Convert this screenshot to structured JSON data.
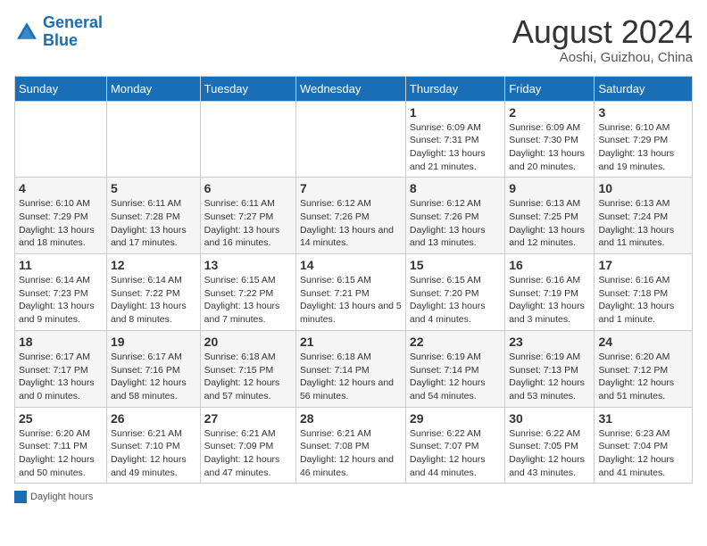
{
  "header": {
    "logo_general": "General",
    "logo_blue": "Blue",
    "main_title": "August 2024",
    "subtitle": "Aoshi, Guizhou, China"
  },
  "weekdays": [
    "Sunday",
    "Monday",
    "Tuesday",
    "Wednesday",
    "Thursday",
    "Friday",
    "Saturday"
  ],
  "weeks": [
    [
      {
        "day": "",
        "info": ""
      },
      {
        "day": "",
        "info": ""
      },
      {
        "day": "",
        "info": ""
      },
      {
        "day": "",
        "info": ""
      },
      {
        "day": "1",
        "info": "Sunrise: 6:09 AM\nSunset: 7:31 PM\nDaylight: 13 hours and 21 minutes."
      },
      {
        "day": "2",
        "info": "Sunrise: 6:09 AM\nSunset: 7:30 PM\nDaylight: 13 hours and 20 minutes."
      },
      {
        "day": "3",
        "info": "Sunrise: 6:10 AM\nSunset: 7:29 PM\nDaylight: 13 hours and 19 minutes."
      }
    ],
    [
      {
        "day": "4",
        "info": "Sunrise: 6:10 AM\nSunset: 7:29 PM\nDaylight: 13 hours and 18 minutes."
      },
      {
        "day": "5",
        "info": "Sunrise: 6:11 AM\nSunset: 7:28 PM\nDaylight: 13 hours and 17 minutes."
      },
      {
        "day": "6",
        "info": "Sunrise: 6:11 AM\nSunset: 7:27 PM\nDaylight: 13 hours and 16 minutes."
      },
      {
        "day": "7",
        "info": "Sunrise: 6:12 AM\nSunset: 7:26 PM\nDaylight: 13 hours and 14 minutes."
      },
      {
        "day": "8",
        "info": "Sunrise: 6:12 AM\nSunset: 7:26 PM\nDaylight: 13 hours and 13 minutes."
      },
      {
        "day": "9",
        "info": "Sunrise: 6:13 AM\nSunset: 7:25 PM\nDaylight: 13 hours and 12 minutes."
      },
      {
        "day": "10",
        "info": "Sunrise: 6:13 AM\nSunset: 7:24 PM\nDaylight: 13 hours and 11 minutes."
      }
    ],
    [
      {
        "day": "11",
        "info": "Sunrise: 6:14 AM\nSunset: 7:23 PM\nDaylight: 13 hours and 9 minutes."
      },
      {
        "day": "12",
        "info": "Sunrise: 6:14 AM\nSunset: 7:22 PM\nDaylight: 13 hours and 8 minutes."
      },
      {
        "day": "13",
        "info": "Sunrise: 6:15 AM\nSunset: 7:22 PM\nDaylight: 13 hours and 7 minutes."
      },
      {
        "day": "14",
        "info": "Sunrise: 6:15 AM\nSunset: 7:21 PM\nDaylight: 13 hours and 5 minutes."
      },
      {
        "day": "15",
        "info": "Sunrise: 6:15 AM\nSunset: 7:20 PM\nDaylight: 13 hours and 4 minutes."
      },
      {
        "day": "16",
        "info": "Sunrise: 6:16 AM\nSunset: 7:19 PM\nDaylight: 13 hours and 3 minutes."
      },
      {
        "day": "17",
        "info": "Sunrise: 6:16 AM\nSunset: 7:18 PM\nDaylight: 13 hours and 1 minute."
      }
    ],
    [
      {
        "day": "18",
        "info": "Sunrise: 6:17 AM\nSunset: 7:17 PM\nDaylight: 13 hours and 0 minutes."
      },
      {
        "day": "19",
        "info": "Sunrise: 6:17 AM\nSunset: 7:16 PM\nDaylight: 12 hours and 58 minutes."
      },
      {
        "day": "20",
        "info": "Sunrise: 6:18 AM\nSunset: 7:15 PM\nDaylight: 12 hours and 57 minutes."
      },
      {
        "day": "21",
        "info": "Sunrise: 6:18 AM\nSunset: 7:14 PM\nDaylight: 12 hours and 56 minutes."
      },
      {
        "day": "22",
        "info": "Sunrise: 6:19 AM\nSunset: 7:14 PM\nDaylight: 12 hours and 54 minutes."
      },
      {
        "day": "23",
        "info": "Sunrise: 6:19 AM\nSunset: 7:13 PM\nDaylight: 12 hours and 53 minutes."
      },
      {
        "day": "24",
        "info": "Sunrise: 6:20 AM\nSunset: 7:12 PM\nDaylight: 12 hours and 51 minutes."
      }
    ],
    [
      {
        "day": "25",
        "info": "Sunrise: 6:20 AM\nSunset: 7:11 PM\nDaylight: 12 hours and 50 minutes."
      },
      {
        "day": "26",
        "info": "Sunrise: 6:21 AM\nSunset: 7:10 PM\nDaylight: 12 hours and 49 minutes."
      },
      {
        "day": "27",
        "info": "Sunrise: 6:21 AM\nSunset: 7:09 PM\nDaylight: 12 hours and 47 minutes."
      },
      {
        "day": "28",
        "info": "Sunrise: 6:21 AM\nSunset: 7:08 PM\nDaylight: 12 hours and 46 minutes."
      },
      {
        "day": "29",
        "info": "Sunrise: 6:22 AM\nSunset: 7:07 PM\nDaylight: 12 hours and 44 minutes."
      },
      {
        "day": "30",
        "info": "Sunrise: 6:22 AM\nSunset: 7:05 PM\nDaylight: 12 hours and 43 minutes."
      },
      {
        "day": "31",
        "info": "Sunrise: 6:23 AM\nSunset: 7:04 PM\nDaylight: 12 hours and 41 minutes."
      }
    ]
  ],
  "legend": {
    "label": "Daylight hours"
  }
}
